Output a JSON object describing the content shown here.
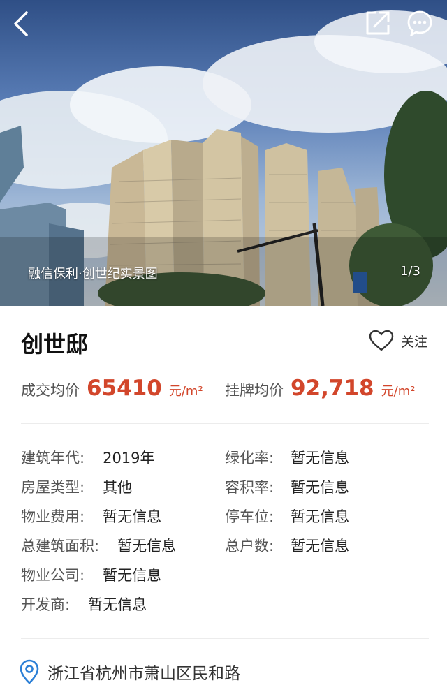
{
  "hero": {
    "caption": "融信保利·创世纪实景图",
    "counter": "1/3"
  },
  "header": {
    "back_icon": "back-arrow-icon",
    "share_icon": "share-external-icon",
    "more_icon": "more-chat-icon"
  },
  "community": {
    "name": "创世邸",
    "follow_label": "关注"
  },
  "prices": {
    "deal_label": "成交均价",
    "deal_value": "65410",
    "deal_unit": "元/m²",
    "list_label": "挂牌均价",
    "list_value": "92,718",
    "list_unit": "元/m²"
  },
  "info": {
    "build_year_k": "建筑年代:",
    "build_year_v": "2019年",
    "green_k": "绿化率:",
    "green_v": "暂无信息",
    "type_k": "房屋类型:",
    "type_v": "其他",
    "far_k": "容积率:",
    "far_v": "暂无信息",
    "fee_k": "物业费用:",
    "fee_v": "暂无信息",
    "parking_k": "停车位:",
    "parking_v": "暂无信息",
    "area_k": "总建筑面积:",
    "area_v": "暂无信息",
    "households_k": "总户数:",
    "households_v": "暂无信息",
    "company_k": "物业公司:",
    "company_v": "暂无信息",
    "developer_k": "开发商:",
    "developer_v": "暂无信息"
  },
  "address": {
    "icon": "location-pin-icon",
    "text": "浙江省杭州市萧山区民和路"
  },
  "colors": {
    "accent": "#d2462b",
    "pin": "#2b7fd6"
  }
}
